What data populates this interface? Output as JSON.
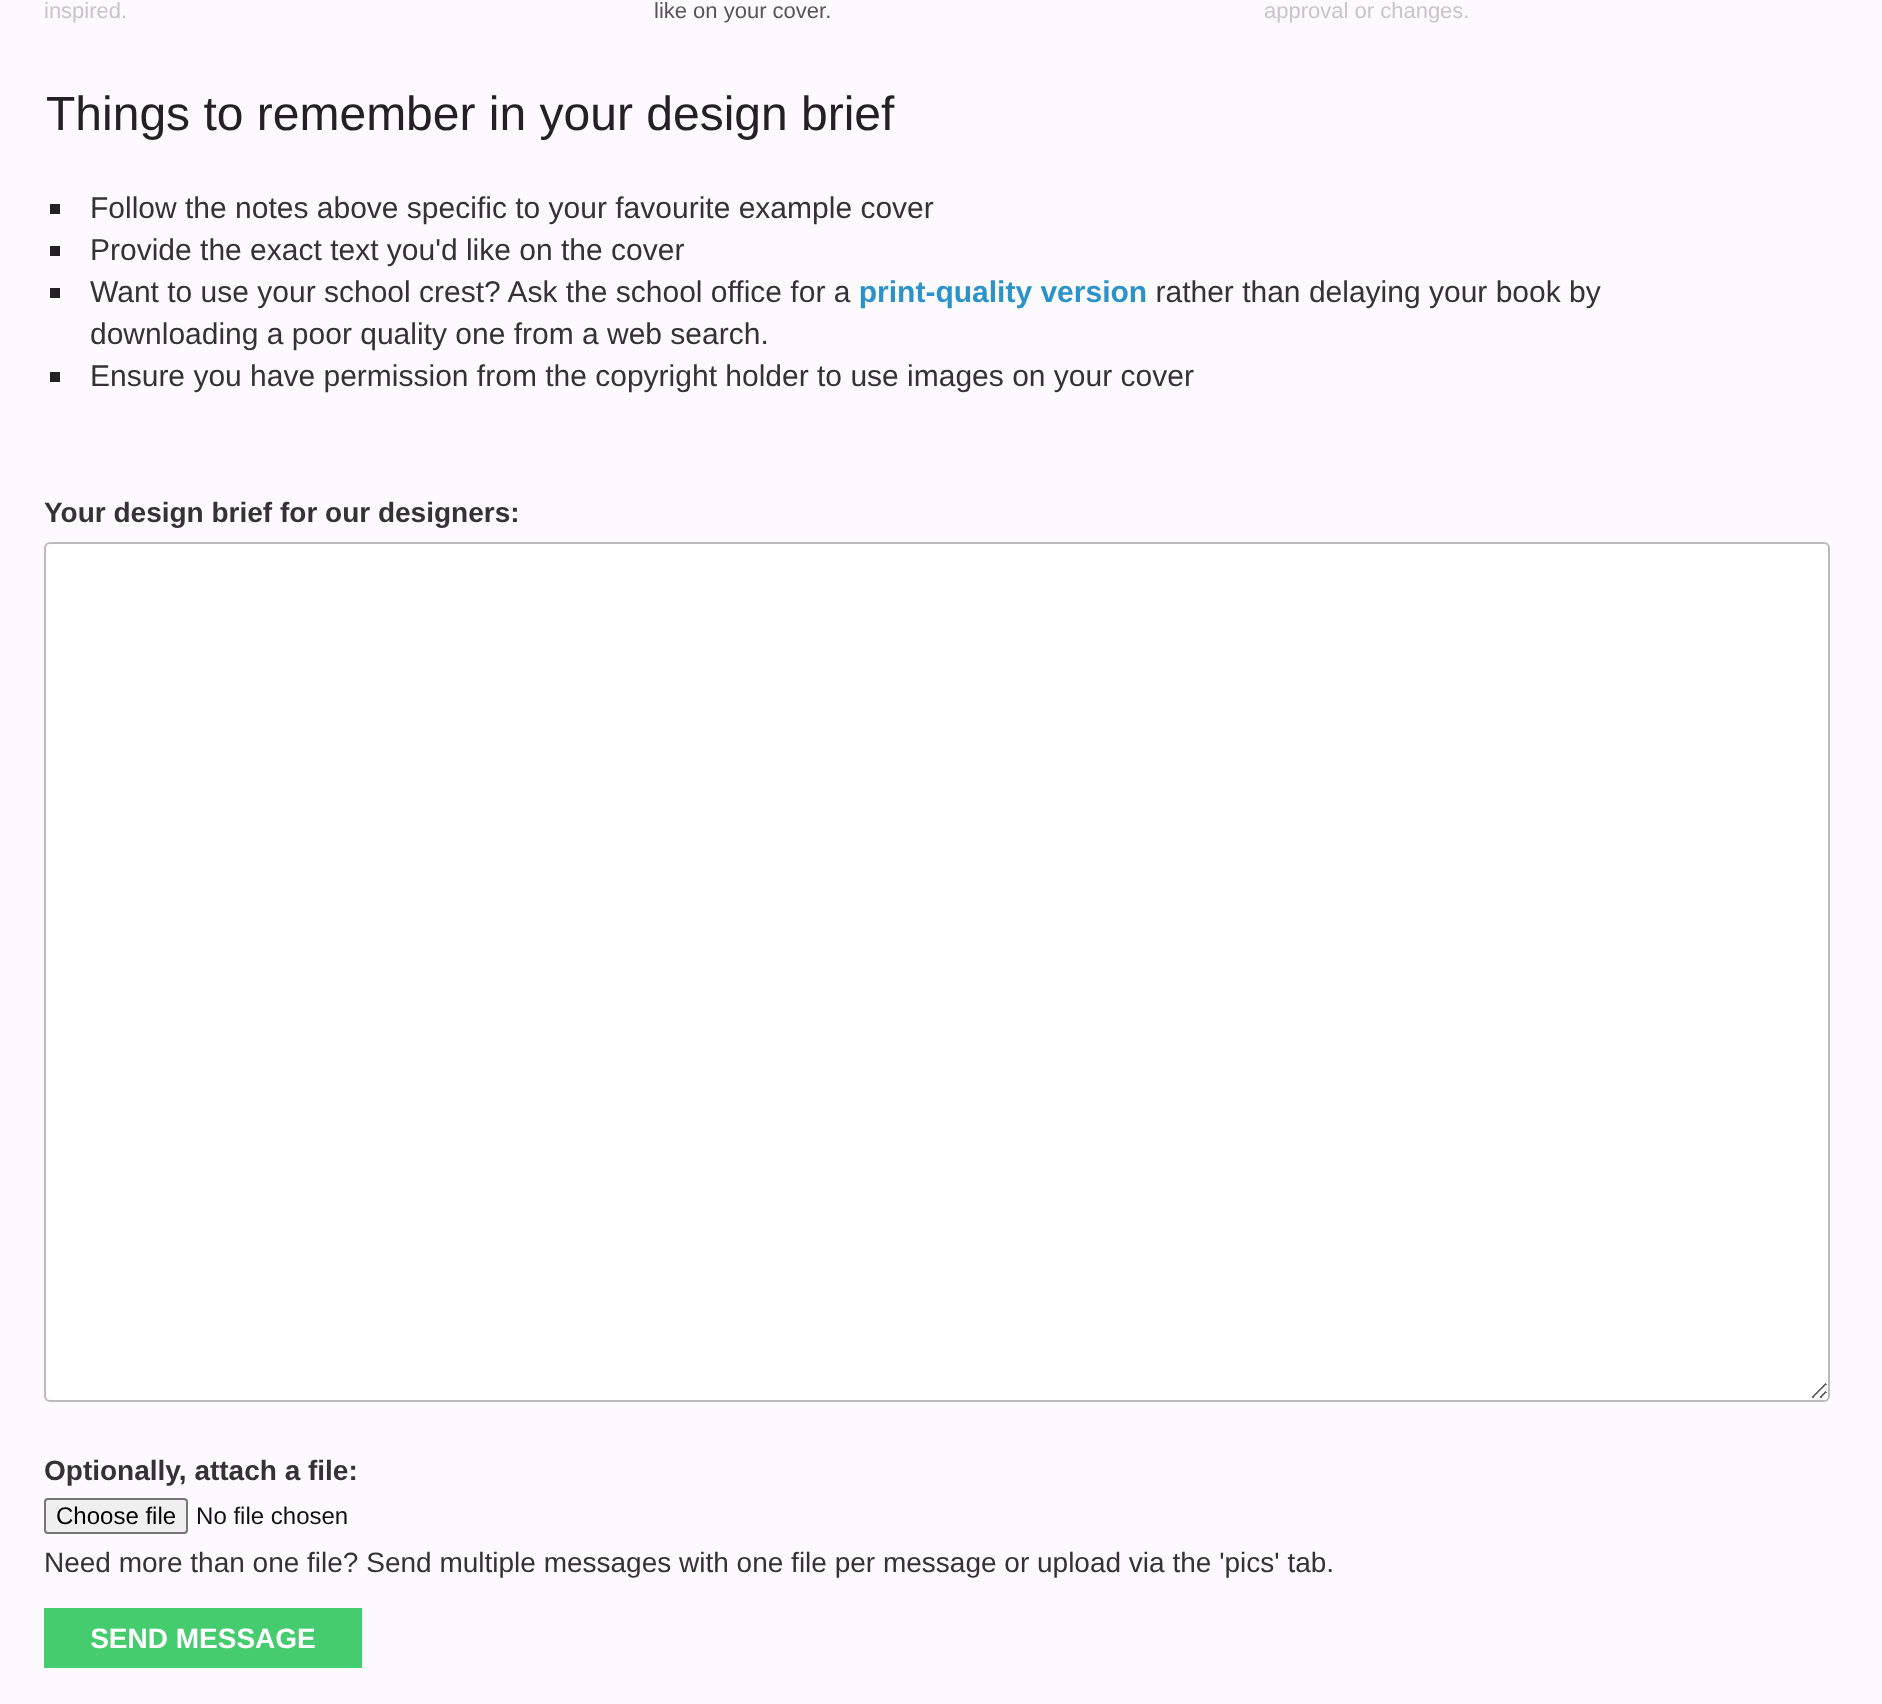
{
  "previous_steps": [
    "inspired.",
    "like on your cover.",
    "approval or changes."
  ],
  "heading": "Things to remember in your design brief",
  "tips": [
    {
      "text": "Follow the notes above specific to your favourite example cover"
    },
    {
      "text": "Provide the exact text you'd like on the cover"
    },
    {
      "text": "Want to use your school crest? Ask the school office for a",
      "link": "print-quality version",
      "after": "rather than delaying your book by downloading a poor quality one from a web search."
    },
    {
      "text": "Ensure you have permission from the copyright holder to use images on your cover"
    }
  ],
  "brief_label": "Your design brief for our designers:",
  "attach_label": "Optionally, attach a file:",
  "file_button": "Choose file",
  "file_status": "No file chosen",
  "file_note": "Need more than one file? Send multiple messages with one file per message or upload via the 'pics' tab.",
  "send_button": "SEND MESSAGE"
}
